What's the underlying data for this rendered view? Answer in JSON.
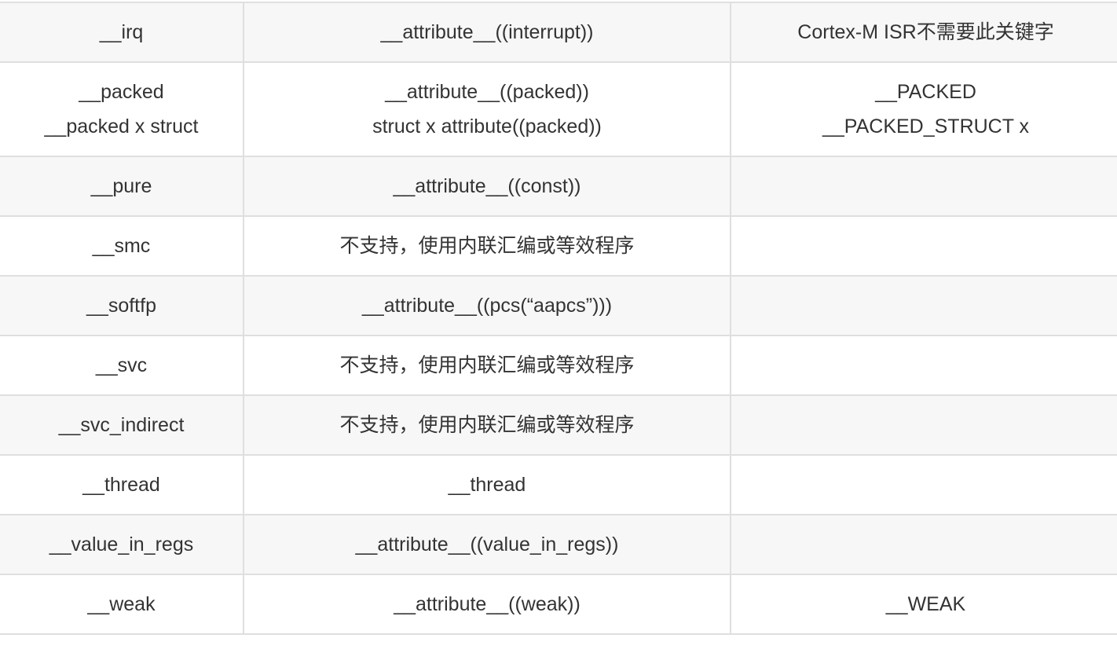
{
  "rows": [
    {
      "c1": [
        "__irq"
      ],
      "c2": [
        "__attribute__((interrupt))"
      ],
      "c3": [
        "Cortex-M ISR不需要此关键字"
      ]
    },
    {
      "c1": [
        "__packed",
        "__packed x struct"
      ],
      "c2": [
        "__attribute__((packed))",
        "struct x attribute((packed))"
      ],
      "c3": [
        "__PACKED",
        "__PACKED_STRUCT x"
      ]
    },
    {
      "c1": [
        "__pure"
      ],
      "c2": [
        "__attribute__((const))"
      ],
      "c3": []
    },
    {
      "c1": [
        "__smc"
      ],
      "c2": [
        "不支持，使用内联汇编或等效程序"
      ],
      "c3": []
    },
    {
      "c1": [
        "__softfp"
      ],
      "c2": [
        "__attribute__((pcs(“aapcs”)))"
      ],
      "c3": []
    },
    {
      "c1": [
        "__svc"
      ],
      "c2": [
        "不支持，使用内联汇编或等效程序"
      ],
      "c3": []
    },
    {
      "c1": [
        "__svc_indirect"
      ],
      "c2": [
        "不支持，使用内联汇编或等效程序"
      ],
      "c3": []
    },
    {
      "c1": [
        "__thread"
      ],
      "c2": [
        "__thread"
      ],
      "c3": []
    },
    {
      "c1": [
        "__value_in_regs"
      ],
      "c2": [
        "__attribute__((value_in_regs))"
      ],
      "c3": []
    },
    {
      "c1": [
        "__weak"
      ],
      "c2": [
        "__attribute__((weak))"
      ],
      "c3": [
        "__WEAK"
      ]
    }
  ]
}
